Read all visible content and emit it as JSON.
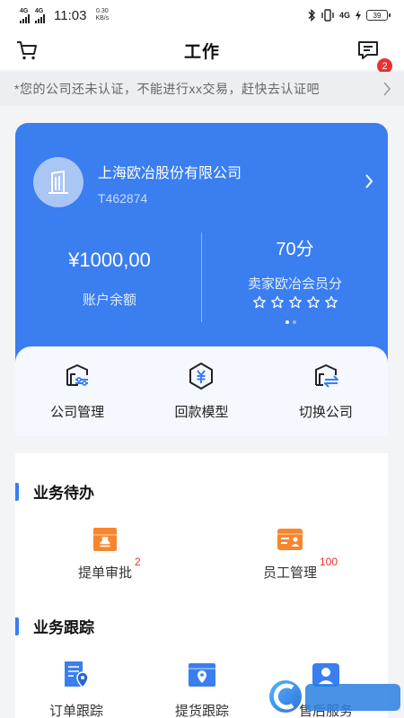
{
  "status_bar": {
    "net1": "4G",
    "net2": "4G",
    "time": "11:03",
    "speed_value": "0.30",
    "speed_unit": "KB/s",
    "net_right": "4G",
    "battery": "39"
  },
  "header": {
    "title": "工作",
    "message_badge": "2"
  },
  "notice": {
    "text": "*您的公司还未认证，不能进行xx交易，赶快去认证吧"
  },
  "company": {
    "name": "上海欧冶股份有限公司",
    "code": "T462874",
    "balance_value": "¥1000,00",
    "balance_label": "账户余额",
    "score_value": "70分",
    "score_label": "卖家欧冶会员分",
    "stars_filled": 0,
    "stars_total": 5
  },
  "actions": [
    {
      "label": "公司管理",
      "icon": "building-settings-icon"
    },
    {
      "label": "回款模型",
      "icon": "hexagon-yuan-icon"
    },
    {
      "label": "切换公司",
      "icon": "building-switch-icon"
    }
  ],
  "todo": {
    "title": "业务待办",
    "items": [
      {
        "label": "提单审批",
        "count": "2",
        "icon": "stamp-box-icon"
      },
      {
        "label": "员工管理",
        "count": "100",
        "icon": "id-card-icon"
      }
    ]
  },
  "tracking": {
    "title": "业务跟踪",
    "items": [
      {
        "label": "订单跟踪",
        "icon": "order-location-icon"
      },
      {
        "label": "提货跟踪",
        "icon": "box-location-icon"
      },
      {
        "label": "售后服务",
        "icon": "service-icon"
      }
    ]
  },
  "colors": {
    "primary": "#3a7ef0",
    "accent_orange": "#f7852f",
    "badge_red": "#e8322f"
  }
}
